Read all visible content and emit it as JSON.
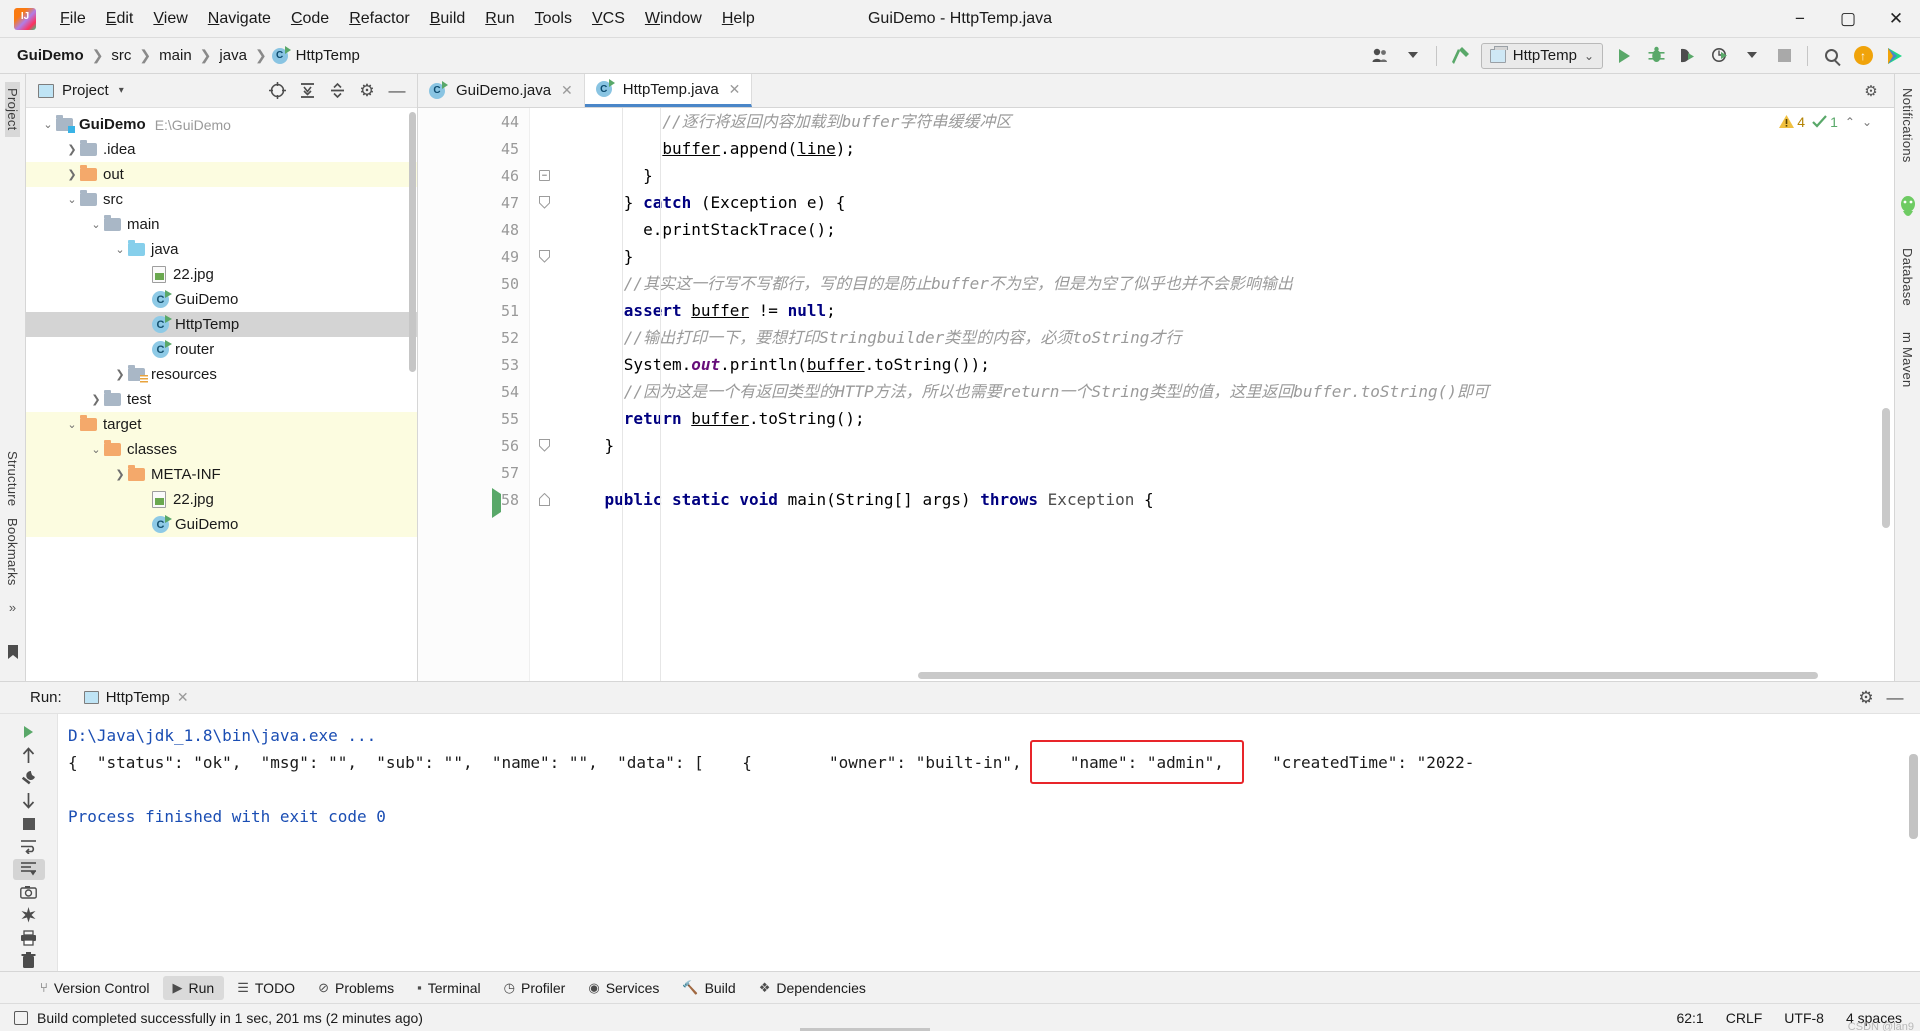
{
  "window": {
    "title": "GuiDemo - HttpTemp.java",
    "minimize": "−",
    "maximize": "▢",
    "close": "✕"
  },
  "menu": {
    "items": [
      "File",
      "Edit",
      "View",
      "Navigate",
      "Code",
      "Refactor",
      "Build",
      "Run",
      "Tools",
      "VCS",
      "Window",
      "Help"
    ]
  },
  "breadcrumb": {
    "project": "GuiDemo",
    "items": [
      "src",
      "main",
      "java"
    ],
    "file": "HttpTemp",
    "separator": "❯",
    "class_glyph": "C"
  },
  "toolbar": {
    "run_config_name": "HttpTemp",
    "run_config_caret": "⌄",
    "icons": [
      {
        "name": "user-account-icon",
        "glyph": "👥"
      },
      {
        "name": "build-hammer-icon",
        "glyph": "🔨"
      },
      {
        "name": "run-icon",
        "glyph": "▶"
      },
      {
        "name": "debug-icon",
        "glyph": "🐞"
      },
      {
        "name": "run-with-coverage-icon",
        "glyph": "▣"
      },
      {
        "name": "profiler-icon",
        "glyph": "◷"
      },
      {
        "name": "stop-icon",
        "glyph": "■"
      },
      {
        "name": "search-everywhere-icon",
        "glyph": "🔍"
      },
      {
        "name": "update-project-icon",
        "glyph": "↑"
      },
      {
        "name": "ide-feature-icon",
        "glyph": "▶"
      }
    ]
  },
  "left_rail": {
    "project_label": "Project",
    "structure_label": "Structure",
    "bookmarks_label": "Bookmarks",
    "more_glyph": "»"
  },
  "right_rail": {
    "notifications_label": "Notifications",
    "database_label": "Database",
    "maven_label": "m Maven"
  },
  "project_panel": {
    "title": "Project",
    "caret": "▾",
    "actions": [
      {
        "name": "select-opened-file-icon",
        "glyph": "⊕"
      },
      {
        "name": "expand-all-icon",
        "glyph": "⤓"
      },
      {
        "name": "collapse-all-icon",
        "glyph": "⤒"
      },
      {
        "name": "settings-gear-icon",
        "glyph": "⚙"
      },
      {
        "name": "hide-panel-icon",
        "glyph": "—"
      }
    ],
    "tree": [
      {
        "label": "GuiDemo",
        "path": "E:\\GuiDemo",
        "indent": 0,
        "arrow": "⌄",
        "icon": "module-folder",
        "bold": true,
        "state": "normal"
      },
      {
        "label": ".idea",
        "path": "",
        "indent": 1,
        "arrow": "❯",
        "icon": "folder-gray",
        "bold": false,
        "state": "normal"
      },
      {
        "label": "out",
        "path": "",
        "indent": 1,
        "arrow": "❯",
        "icon": "folder-orange",
        "bold": false,
        "state": "highlight"
      },
      {
        "label": "src",
        "path": "",
        "indent": 1,
        "arrow": "⌄",
        "icon": "folder-gray",
        "bold": false,
        "state": "normal"
      },
      {
        "label": "main",
        "path": "",
        "indent": 2,
        "arrow": "⌄",
        "icon": "folder-gray",
        "bold": false,
        "state": "normal"
      },
      {
        "label": "java",
        "path": "",
        "indent": 3,
        "arrow": "⌄",
        "icon": "folder-blue",
        "bold": false,
        "state": "normal"
      },
      {
        "label": "22.jpg",
        "path": "",
        "indent": 4,
        "arrow": "",
        "icon": "image-file",
        "bold": false,
        "state": "normal"
      },
      {
        "label": "GuiDemo",
        "path": "",
        "indent": 4,
        "arrow": "",
        "icon": "java-class",
        "bold": false,
        "state": "normal"
      },
      {
        "label": "HttpTemp",
        "path": "",
        "indent": 4,
        "arrow": "",
        "icon": "java-class",
        "bold": false,
        "state": "selected"
      },
      {
        "label": "router",
        "path": "",
        "indent": 4,
        "arrow": "",
        "icon": "java-class",
        "bold": false,
        "state": "normal"
      },
      {
        "label": "resources",
        "path": "",
        "indent": 3,
        "arrow": "❯",
        "icon": "folder-resources",
        "bold": false,
        "state": "normal"
      },
      {
        "label": "test",
        "path": "",
        "indent": 2,
        "arrow": "❯",
        "icon": "folder-gray",
        "bold": false,
        "state": "normal"
      },
      {
        "label": "target",
        "path": "",
        "indent": 1,
        "arrow": "⌄",
        "icon": "folder-orange",
        "bold": false,
        "state": "highlight"
      },
      {
        "label": "classes",
        "path": "",
        "indent": 2,
        "arrow": "⌄",
        "icon": "folder-orange",
        "bold": false,
        "state": "highlight"
      },
      {
        "label": "META-INF",
        "path": "",
        "indent": 3,
        "arrow": "❯",
        "icon": "folder-orange",
        "bold": false,
        "state": "highlight"
      },
      {
        "label": "22.jpg",
        "path": "",
        "indent": 4,
        "arrow": "",
        "icon": "image-file",
        "bold": false,
        "state": "highlight"
      },
      {
        "label": "GuiDemo",
        "path": "",
        "indent": 4,
        "arrow": "",
        "icon": "java-class",
        "bold": false,
        "state": "highlight"
      }
    ]
  },
  "editor": {
    "tabs": [
      {
        "label": "GuiDemo.java",
        "active": false,
        "close": "✕"
      },
      {
        "label": "HttpTemp.java",
        "active": true,
        "close": "✕"
      }
    ],
    "gear_icon": "⚙",
    "inspections": {
      "warning_count": "4",
      "warning_glyph": "⚠",
      "ok_count": "1",
      "ok_glyph": "✓",
      "up_arrow": "⌃",
      "down_arrow": "⌄"
    },
    "lines": [
      {
        "num": "44",
        "indent": 10,
        "fold": "",
        "run": false,
        "tokens": [
          {
            "t": "//逐行将返回内容加载到buffer字符串缓缓冲区",
            "c": "cmt"
          }
        ]
      },
      {
        "num": "45",
        "indent": 10,
        "fold": "",
        "run": false,
        "tokens": [
          {
            "t": "buffer",
            "c": "fld-u"
          },
          {
            "t": ".append(",
            "c": "id"
          },
          {
            "t": "line",
            "c": "fld-u"
          },
          {
            "t": ");",
            "c": "id"
          }
        ]
      },
      {
        "num": "46",
        "indent": 8,
        "fold": "minus",
        "run": false,
        "tokens": [
          {
            "t": "}",
            "c": "id"
          }
        ]
      },
      {
        "num": "47",
        "indent": 6,
        "fold": "end",
        "run": false,
        "tokens": [
          {
            "t": "} ",
            "c": "id"
          },
          {
            "t": "catch",
            "c": "k"
          },
          {
            "t": " (Exception e) {",
            "c": "id"
          }
        ]
      },
      {
        "num": "48",
        "indent": 8,
        "fold": "",
        "run": false,
        "tokens": [
          {
            "t": "e.printStackTrace();",
            "c": "id"
          }
        ]
      },
      {
        "num": "49",
        "indent": 6,
        "fold": "end",
        "run": false,
        "tokens": [
          {
            "t": "}",
            "c": "id"
          }
        ]
      },
      {
        "num": "50",
        "indent": 6,
        "fold": "",
        "run": false,
        "tokens": [
          {
            "t": "//其实这一行写不写都行，写的目的是防止buffer不为空，但是为空了似乎也并不会影响输出",
            "c": "cmt"
          }
        ]
      },
      {
        "num": "51",
        "indent": 6,
        "fold": "",
        "run": false,
        "tokens": [
          {
            "t": "assert ",
            "c": "k"
          },
          {
            "t": "buffer",
            "c": "fld-u"
          },
          {
            "t": " != ",
            "c": "id"
          },
          {
            "t": "null",
            "c": "k"
          },
          {
            "t": ";",
            "c": "id"
          }
        ]
      },
      {
        "num": "52",
        "indent": 6,
        "fold": "",
        "run": false,
        "tokens": [
          {
            "t": "//输出打印一下，要想打印Stringbuilder类型的内容，必须toString才行",
            "c": "cmt"
          }
        ]
      },
      {
        "num": "53",
        "indent": 6,
        "fold": "",
        "run": false,
        "tokens": [
          {
            "t": "System.",
            "c": "id"
          },
          {
            "t": "out",
            "c": "fld"
          },
          {
            "t": ".println(",
            "c": "id"
          },
          {
            "t": "buffer",
            "c": "fld-u"
          },
          {
            "t": ".toString());",
            "c": "id"
          }
        ]
      },
      {
        "num": "54",
        "indent": 6,
        "fold": "",
        "run": false,
        "tokens": [
          {
            "t": "//因为这是一个有返回类型的HTTP方法，所以也需要return一个String类型的值，这里返回buffer.toString()即可",
            "c": "cmt"
          }
        ]
      },
      {
        "num": "55",
        "indent": 6,
        "fold": "",
        "run": false,
        "tokens": [
          {
            "t": "return ",
            "c": "k"
          },
          {
            "t": "buffer",
            "c": "fld-u"
          },
          {
            "t": ".toString();",
            "c": "id"
          }
        ]
      },
      {
        "num": "56",
        "indent": 4,
        "fold": "end",
        "run": false,
        "tokens": [
          {
            "t": "}",
            "c": "id"
          }
        ]
      },
      {
        "num": "57",
        "indent": 4,
        "fold": "",
        "run": false,
        "tokens": []
      },
      {
        "num": "58",
        "indent": 4,
        "fold": "start",
        "run": true,
        "tokens": [
          {
            "t": "public ",
            "c": "k"
          },
          {
            "t": "static ",
            "c": "k"
          },
          {
            "t": "void ",
            "c": "k"
          },
          {
            "t": "main(String[] args) ",
            "c": "id"
          },
          {
            "t": "throws ",
            "c": "k"
          },
          {
            "t": "Exception",
            "c": "cls"
          },
          {
            "t": " {",
            "c": "id"
          }
        ]
      }
    ]
  },
  "run_panel": {
    "label": "Run:",
    "tab_name": "HttpTemp",
    "tab_close": "✕",
    "header_actions": [
      {
        "name": "run-settings-gear-icon",
        "glyph": "⚙"
      },
      {
        "name": "hide-run-panel-icon",
        "glyph": "—"
      }
    ],
    "tools": [
      {
        "name": "rerun-icon",
        "glyph": "▶",
        "selected": false
      },
      {
        "name": "scroll-up-icon",
        "glyph": "↑",
        "selected": false
      },
      {
        "name": "settings-wrench-icon",
        "glyph": "🔧",
        "selected": false
      },
      {
        "name": "scroll-down-icon",
        "glyph": "↓",
        "selected": false
      },
      {
        "name": "stop-process-icon",
        "glyph": "■",
        "selected": false
      },
      {
        "name": "soft-wrap-icon",
        "glyph": "↹",
        "selected": false
      },
      {
        "name": "scroll-to-end-icon",
        "glyph": "⇟",
        "selected": true
      },
      {
        "name": "screenshot-icon",
        "glyph": "📷",
        "selected": false
      },
      {
        "name": "clear-all-icon",
        "glyph": "✳",
        "selected": false
      },
      {
        "name": "print-icon",
        "glyph": "🖨",
        "selected": false
      },
      {
        "name": "delete-icon",
        "glyph": "🗑",
        "selected": false
      }
    ],
    "console": {
      "command": "D:\\Java\\jdk_1.8\\bin\\java.exe ...",
      "output": "{  \"status\": \"ok\",  \"msg\": \"\",  \"sub\": \"\",  \"name\": \"\",  \"data\": [    {        \"owner\": \"built-in\",     \"name\": \"admin\",     \"createdTime\": \"2022-",
      "finished": "Process finished with exit code 0",
      "highlight_text": "\"name\": \"admin\",",
      "highlight_color": "#e8252a"
    }
  },
  "bottom_bar": {
    "items": [
      {
        "label": "Version Control",
        "icon": "branch-icon",
        "glyph": "⑂",
        "active": false
      },
      {
        "label": "Run",
        "icon": "run-icon",
        "glyph": "▶",
        "active": true
      },
      {
        "label": "TODO",
        "icon": "todo-icon",
        "glyph": "☰",
        "active": false
      },
      {
        "label": "Problems",
        "icon": "problems-icon",
        "glyph": "⊘",
        "active": false
      },
      {
        "label": "Terminal",
        "icon": "terminal-icon",
        "glyph": "▪",
        "active": false
      },
      {
        "label": "Profiler",
        "icon": "profiler-icon",
        "glyph": "◷",
        "active": false
      },
      {
        "label": "Services",
        "icon": "services-icon",
        "glyph": "◉",
        "active": false
      },
      {
        "label": "Build",
        "icon": "build-hammer-icon",
        "glyph": "🔨",
        "active": false
      },
      {
        "label": "Dependencies",
        "icon": "dependencies-icon",
        "glyph": "❖",
        "active": false
      }
    ]
  },
  "status_bar": {
    "message": "Build completed successfully in 1 sec, 201 ms (2 minutes ago)",
    "caret_position": "62:1",
    "line_separator": "CRLF",
    "encoding": "UTF-8",
    "indent": "4 spaces",
    "watermark": "CSDN @lan9"
  }
}
